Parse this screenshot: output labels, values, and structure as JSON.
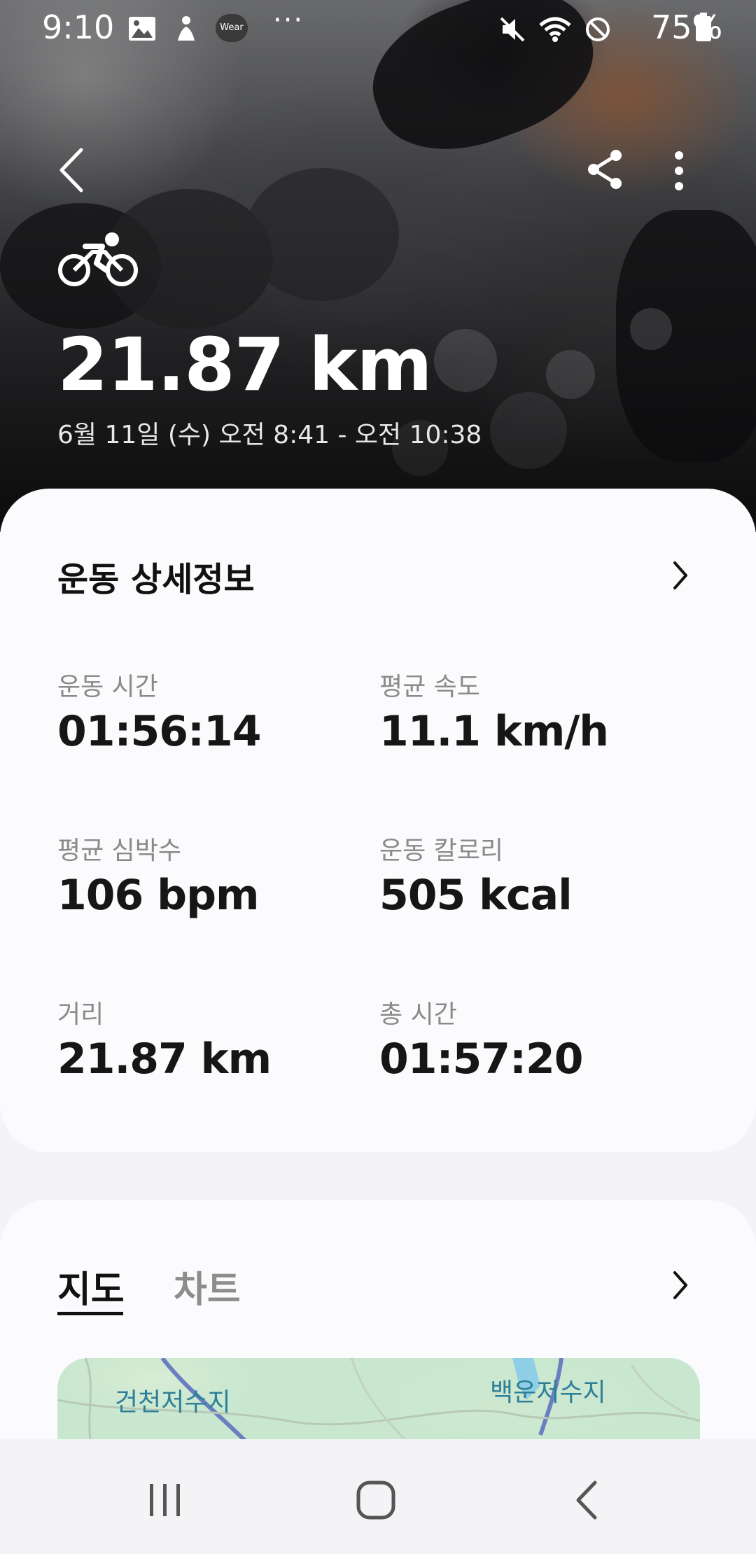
{
  "status_bar": {
    "time": "9:10",
    "battery": "75%",
    "wear_label": "Wear",
    "more": "···"
  },
  "workout": {
    "distance": "21.87 km",
    "date_range": "6월 11일 (수) 오전 8:41 - 오전 10:38",
    "type_icon": "cycling-icon"
  },
  "details": {
    "title": "운동 상세정보",
    "stats": [
      {
        "label": "운동 시간",
        "value": "01:56:14"
      },
      {
        "label": "평균 속도",
        "value": "11.1 km/h"
      },
      {
        "label": "평균 심박수",
        "value": "106 bpm"
      },
      {
        "label": "운동 칼로리",
        "value": "505 kcal"
      },
      {
        "label": "거리",
        "value": "21.87 km"
      },
      {
        "label": "총 시간",
        "value": "01:57:20"
      }
    ]
  },
  "tabs": {
    "map": "지도",
    "chart": "차트"
  },
  "map": {
    "labels": [
      "건천저수지",
      "백운저수지"
    ]
  },
  "colors": {
    "card_bg": "#fbfbfd",
    "page_bg": "#f4f4f6",
    "map_water": "#8ecfe6",
    "map_land": "#c9e7cf"
  }
}
